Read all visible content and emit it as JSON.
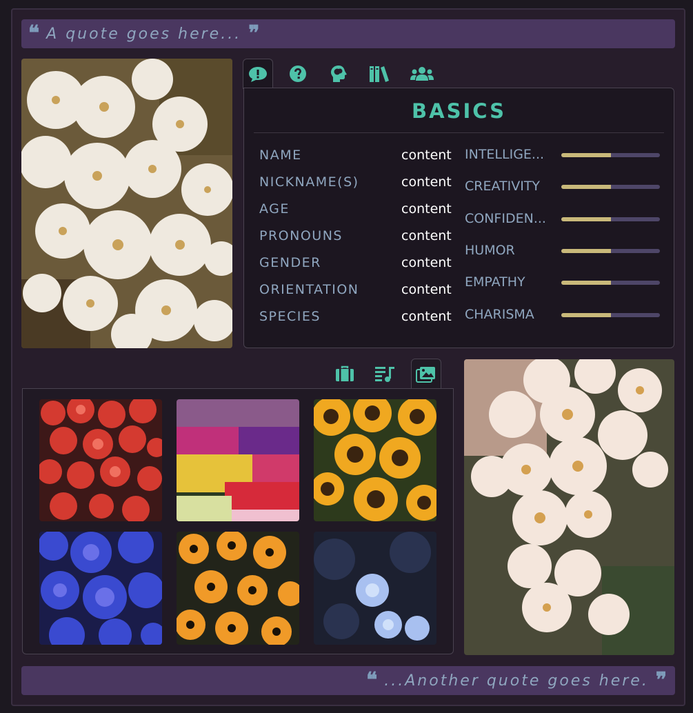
{
  "quotes": {
    "top": "A quote goes here...",
    "bottom": "...Another quote goes here.",
    "open_mark": "❝",
    "close_mark": "❞"
  },
  "top_tabs": [
    {
      "icon": "speech-exclaim-icon",
      "active": true
    },
    {
      "icon": "question-circle-icon",
      "active": false
    },
    {
      "icon": "head-brain-icon",
      "active": false
    },
    {
      "icon": "books-icon",
      "active": false
    },
    {
      "icon": "users-icon",
      "active": false
    }
  ],
  "basics": {
    "title": "BASICS",
    "fields": [
      {
        "label": "NAME",
        "value": "content"
      },
      {
        "label": "NICKNAME(S)",
        "value": "content"
      },
      {
        "label": "AGE",
        "value": "content"
      },
      {
        "label": "PRONOUNS",
        "value": "content"
      },
      {
        "label": "GENDER",
        "value": "content"
      },
      {
        "label": "ORIENTATION",
        "value": "content"
      },
      {
        "label": "SPECIES",
        "value": "content"
      }
    ],
    "stats": [
      {
        "label": "INTELLIGE...",
        "level": 0.5
      },
      {
        "label": "CREATIVITY",
        "level": 0.5
      },
      {
        "label": "CONFIDEN...",
        "level": 0.5
      },
      {
        "label": "HUMOR",
        "level": 0.5
      },
      {
        "label": "EMPATHY",
        "level": 0.5
      },
      {
        "label": "CHARISMA",
        "level": 0.5
      }
    ]
  },
  "bottom_tabs": [
    {
      "icon": "briefcase-icon",
      "active": false
    },
    {
      "icon": "music-list-icon",
      "active": false
    },
    {
      "icon": "images-icon",
      "active": true
    }
  ],
  "gallery": [
    {
      "name": "red-begonias"
    },
    {
      "name": "tulip-field"
    },
    {
      "name": "sunflowers"
    },
    {
      "name": "blue-hydrangeas"
    },
    {
      "name": "orange-daisies"
    },
    {
      "name": "blue-roses"
    }
  ],
  "colors": {
    "accent": "#4ec2a9",
    "label": "#8fa6bf",
    "quote_bar": "#4a3760",
    "bar_fill": "#c9b97a",
    "bar_track": "#4e4668"
  }
}
